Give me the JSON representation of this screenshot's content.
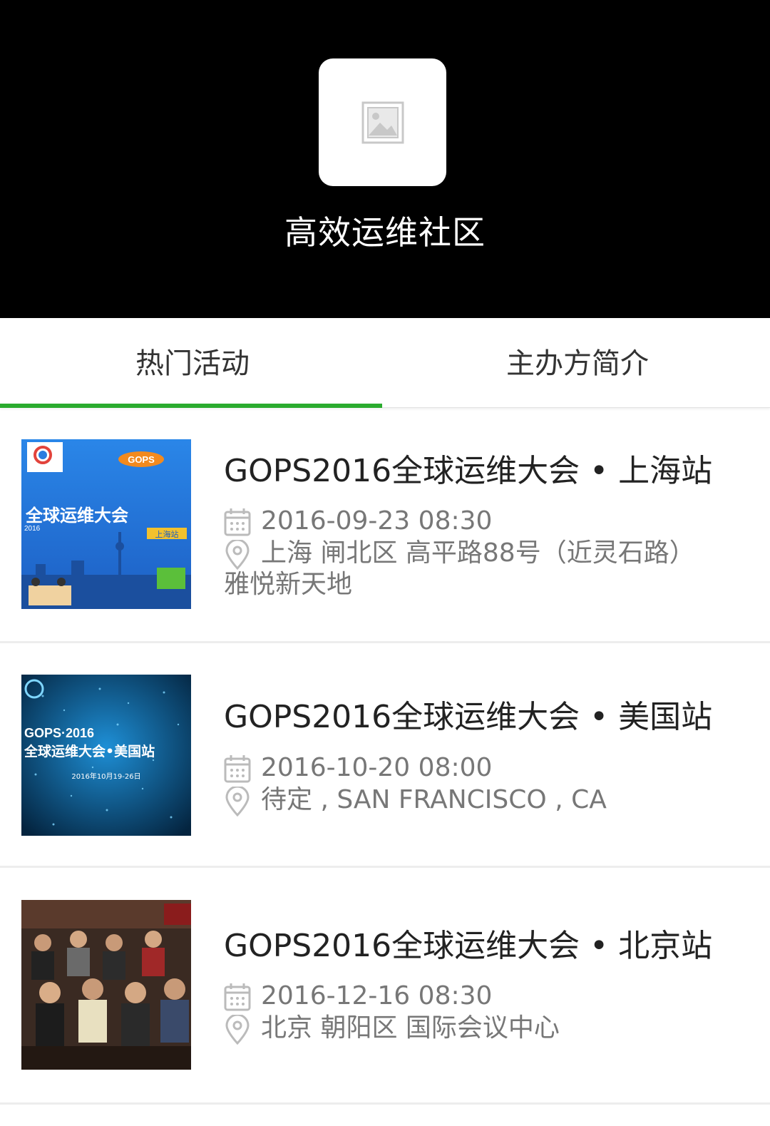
{
  "header": {
    "community_name": "高效运维社区",
    "logo_icon": "image-placeholder-icon"
  },
  "tabs": [
    {
      "label": "热门活动",
      "active": true
    },
    {
      "label": "主办方简介",
      "active": false
    }
  ],
  "colors": {
    "accent": "#2aab2e",
    "header_bg": "#000000"
  },
  "events": [
    {
      "title": "GOPS2016全球运维大会 • 上海站",
      "datetime": "2016-09-23 08:30",
      "address_line1": "上海 闸北区 高平路88号（近灵石路）",
      "address_line2": "雅悦新天地",
      "thumb": {
        "badge": "GOPS",
        "heading": "全球运维大会",
        "year": "2016",
        "city_tag": "上海站"
      }
    },
    {
      "title": "GOPS2016全球运维大会 • 美国站",
      "datetime": "2016-10-20 08:00",
      "address_line1": "待定 , SAN FRANCISCO , CA",
      "thumb": {
        "line1": "GOPS·2016",
        "line2": "全球运维大会•美国站",
        "line3": "2016年10月19-26日"
      }
    },
    {
      "title": "GOPS2016全球运维大会 • 北京站",
      "datetime": "2016-12-16 08:30",
      "address_line1": "北京 朝阳区 国际会议中心"
    }
  ]
}
